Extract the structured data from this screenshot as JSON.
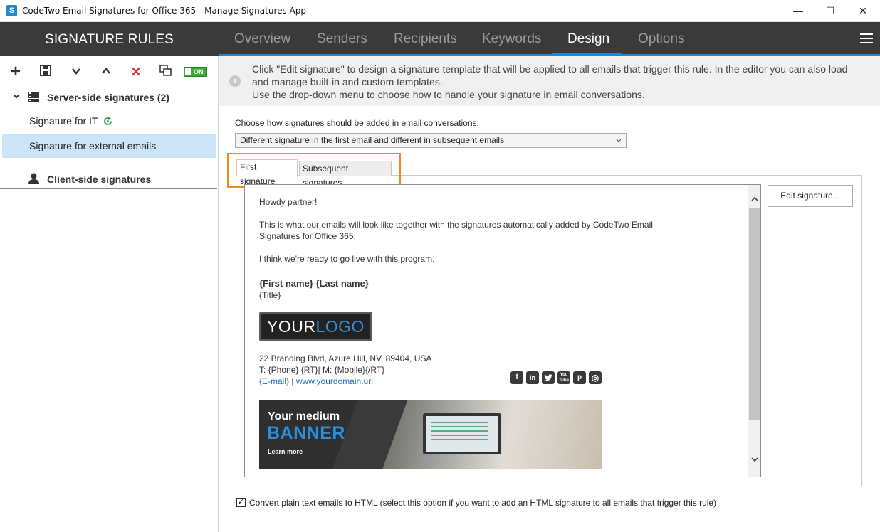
{
  "window": {
    "title": "CodeTwo Email Signatures for Office 365 - Manage Signatures App",
    "app_icon_glyph": "S",
    "minimize": "—",
    "maximize": "☐",
    "close": "✕"
  },
  "sidebar": {
    "header": "SIGNATURE RULES",
    "toolbar": {
      "add": "+",
      "save": "💾",
      "down": "⌄",
      "up": "⌃",
      "delete": "✕",
      "duplicate": "⧉",
      "toggle": "ON"
    },
    "groups": [
      {
        "label": "Server-side signatures (2)",
        "icon": "server-icon"
      },
      {
        "label": "Client-side signatures",
        "icon": "person-icon"
      }
    ],
    "rules": [
      {
        "label": "Signature for IT",
        "icon": "sync-icon"
      },
      {
        "label": "Signature for external emails",
        "selected": true
      }
    ]
  },
  "tabs": [
    "Overview",
    "Senders",
    "Recipients",
    "Keywords",
    "Design",
    "Options"
  ],
  "active_tab": "Design",
  "info": {
    "line1": "Click \"Edit signature\" to design a signature template that will be applied to all emails that trigger this rule. In the editor you can also load",
    "line2": "and manage built-in and custom templates.",
    "line3": "Use the drop-down menu to choose how to handle your signature in email conversations."
  },
  "conversation": {
    "label": "Choose how signatures should be added in email conversations:",
    "selected": "Different signature in the first email and different in subsequent emails"
  },
  "signature_tabs": {
    "first": "First signature",
    "subsequent": "Subsequent signatures"
  },
  "preview": {
    "greeting": "Howdy partner!",
    "body1": "This is what our emails will look like together with the signatures automatically added by CodeTwo Email",
    "body2": "Signatures for Office 365.",
    "body3": "I think we're ready to go live with this program.",
    "name": "{First name} {Last name}",
    "title": "{Title}",
    "logo_your": "YOUR",
    "logo_logo": "LOGO",
    "address": "22 Branding Blvd, Azure Hill, NV, 89404, USA",
    "phone": "T: {Phone} {RT}| M: {Mobile}{/RT}",
    "email": "{E-mail}",
    "separator": " | ",
    "website": "www.yourdomain.url",
    "social": [
      "f",
      "in",
      "t",
      "You Tube",
      "p",
      "◎"
    ],
    "banner": {
      "line1": "Your medium",
      "line2": "BANNER",
      "line3": "Learn more"
    }
  },
  "edit_button": "Edit signature...",
  "convert": {
    "checked": true,
    "label": "Convert plain text emails to HTML (select this option if you want to add an HTML signature to all emails that trigger this rule)"
  },
  "colors": {
    "accent": "#1e88d6",
    "header_bg": "#3a3a3a",
    "highlight": "#f08a1c",
    "selected_row": "#cce4f7",
    "toggle_on": "#3aaa35"
  }
}
